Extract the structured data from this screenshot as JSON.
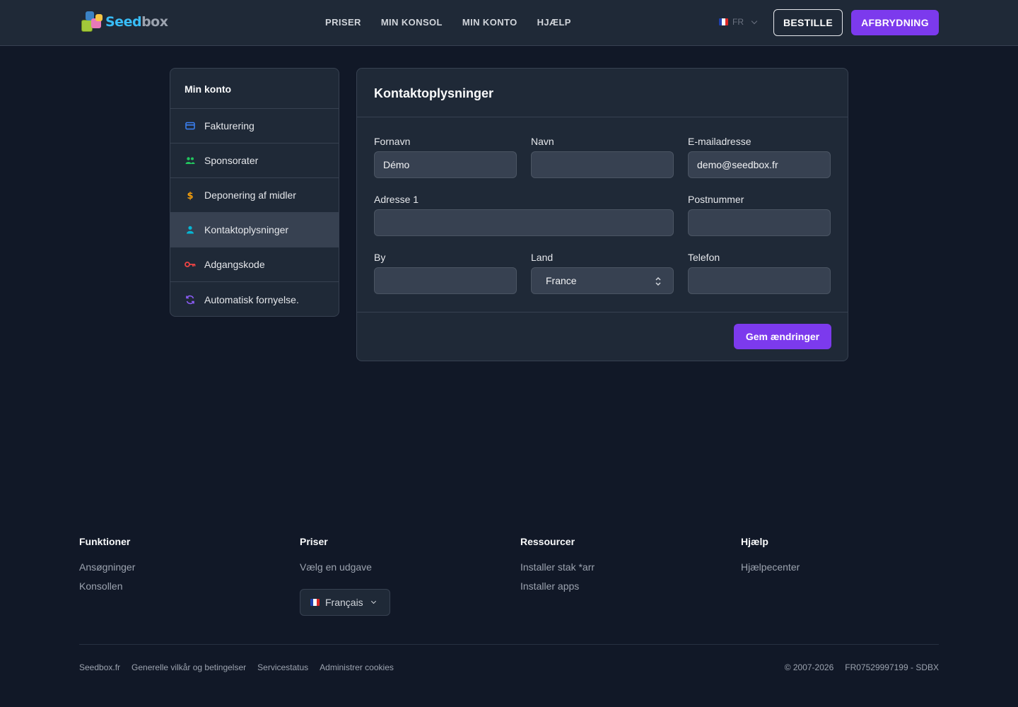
{
  "header": {
    "logo_text_a": "Seed",
    "logo_text_b": "box",
    "nav": [
      "PRISER",
      "MIN KONSOL",
      "MIN KONTO",
      "HJÆLP"
    ],
    "lang_code": "FR",
    "order_label": "BESTILLE",
    "logout_label": "AFBRYDNING"
  },
  "sidebar": {
    "title": "Min konto",
    "items": [
      {
        "label": "Fakturering",
        "icon": "credit-card-icon",
        "color": "#3b82f6"
      },
      {
        "label": "Sponsorater",
        "icon": "users-icon",
        "color": "#22c55e"
      },
      {
        "label": "Deponering af midler",
        "icon": "dollar-icon",
        "color": "#f59e0b"
      },
      {
        "label": "Kontaktoplysninger",
        "icon": "user-icon",
        "color": "#06b6d4",
        "active": true
      },
      {
        "label": "Adgangskode",
        "icon": "key-icon",
        "color": "#ef4444"
      },
      {
        "label": "Automatisk fornyelse.",
        "icon": "refresh-icon",
        "color": "#8b5cf6"
      }
    ]
  },
  "form": {
    "title": "Kontaktoplysninger",
    "fields": {
      "firstname": {
        "label": "Fornavn",
        "value": "Démo"
      },
      "lastname": {
        "label": "Navn",
        "value": ""
      },
      "email": {
        "label": "E-mailadresse",
        "value": "demo@seedbox.fr"
      },
      "address1": {
        "label": "Adresse 1",
        "value": ""
      },
      "postcode": {
        "label": "Postnummer",
        "value": ""
      },
      "city": {
        "label": "By",
        "value": ""
      },
      "country": {
        "label": "Land",
        "value": "France"
      },
      "phone": {
        "label": "Telefon",
        "value": ""
      }
    },
    "save_label": "Gem ændringer"
  },
  "footer": {
    "columns": [
      {
        "title": "Funktioner",
        "links": [
          "Ansøgninger",
          "Konsollen"
        ]
      },
      {
        "title": "Priser",
        "links": [
          "Vælg en udgave"
        ]
      },
      {
        "title": "Ressourcer",
        "links": [
          "Installer stak *arr",
          "Installer apps"
        ]
      },
      {
        "title": "Hjælp",
        "links": [
          "Hjælpecenter"
        ]
      }
    ],
    "language": "Français",
    "bottom_links": [
      "Seedbox.fr",
      "Generelle vilkår og betingelser",
      "Servicestatus",
      "Administrer cookies"
    ],
    "copyright": "© 2007-2026",
    "vat": "FR07529997199 - SDBX"
  },
  "colors": {
    "accent": "#7c3aed",
    "background": "#111827",
    "surface": "#1f2937"
  }
}
